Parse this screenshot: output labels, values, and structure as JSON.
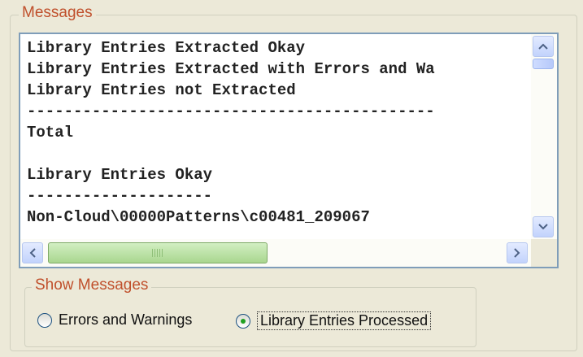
{
  "messages": {
    "title": "Messages",
    "lines": [
      "Library Entries Extracted Okay",
      "Library Entries Extracted with Errors and Wa",
      "Library Entries not Extracted",
      "--------------------------------------------",
      "Total",
      "",
      "Library Entries Okay",
      "--------------------",
      "Non-Cloud\\00000Patterns\\c00481_209067"
    ]
  },
  "show_messages": {
    "title": "Show Messages",
    "options": [
      {
        "label": "Errors and Warnings",
        "selected": false
      },
      {
        "label": "Library Entries Processed",
        "selected": true
      }
    ]
  }
}
